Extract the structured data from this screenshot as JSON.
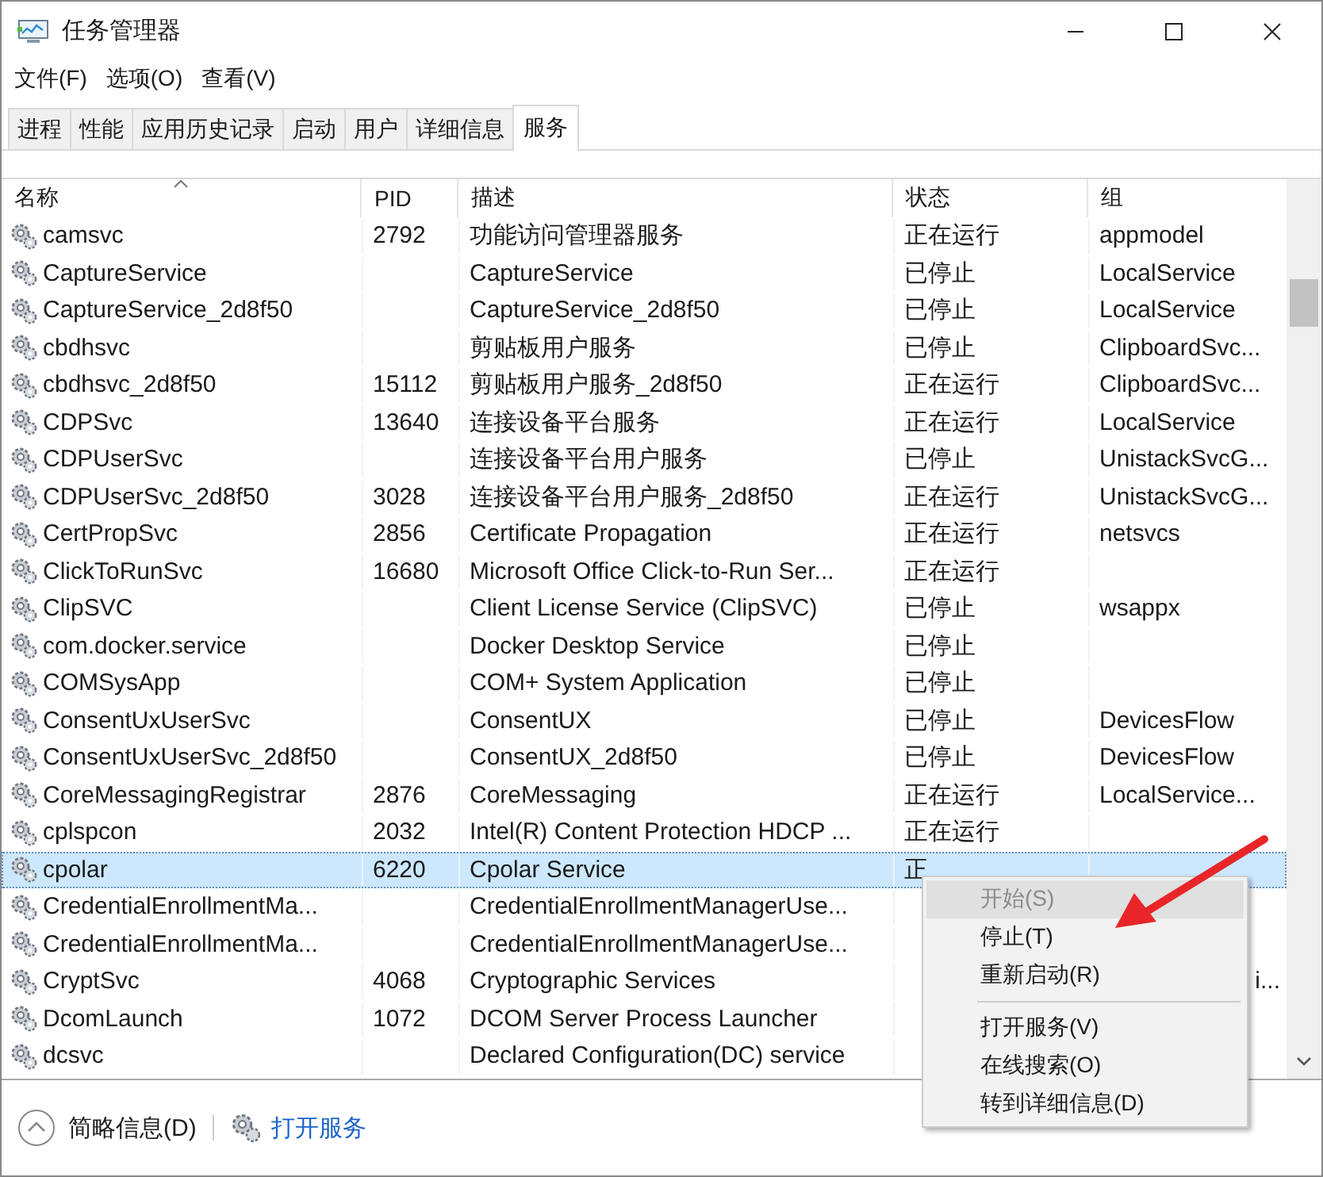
{
  "window": {
    "title": "任务管理器"
  },
  "menu": [
    "文件(F)",
    "选项(O)",
    "查看(V)"
  ],
  "tabs": [
    {
      "label": "进程",
      "selected": false
    },
    {
      "label": "性能",
      "selected": false
    },
    {
      "label": "应用历史记录",
      "selected": false
    },
    {
      "label": "启动",
      "selected": false
    },
    {
      "label": "用户",
      "selected": false
    },
    {
      "label": "详细信息",
      "selected": false
    },
    {
      "label": "服务",
      "selected": true
    }
  ],
  "table": {
    "columns": [
      "名称",
      "PID",
      "描述",
      "状态",
      "组"
    ],
    "rows": [
      {
        "name": "camsvc",
        "pid": "2792",
        "desc": "功能访问管理器服务",
        "status": "正在运行",
        "group": "appmodel",
        "selected": false
      },
      {
        "name": "CaptureService",
        "desc": "CaptureService",
        "status": "已停止",
        "group": "LocalService",
        "selected": false
      },
      {
        "name": "CaptureService_2d8f50",
        "desc": "CaptureService_2d8f50",
        "status": "已停止",
        "group": "LocalService",
        "selected": false
      },
      {
        "name": "cbdhsvc",
        "desc": "剪贴板用户服务",
        "status": "已停止",
        "group": "ClipboardSvc...",
        "selected": false
      },
      {
        "name": "cbdhsvc_2d8f50",
        "pid": "15112",
        "desc": "剪贴板用户服务_2d8f50",
        "status": "正在运行",
        "group": "ClipboardSvc...",
        "selected": false
      },
      {
        "name": "CDPSvc",
        "pid": "13640",
        "desc": "连接设备平台服务",
        "status": "正在运行",
        "group": "LocalService",
        "selected": false
      },
      {
        "name": "CDPUserSvc",
        "desc": "连接设备平台用户服务",
        "status": "已停止",
        "group": "UnistackSvcG...",
        "selected": false
      },
      {
        "name": "CDPUserSvc_2d8f50",
        "pid": "3028",
        "desc": "连接设备平台用户服务_2d8f50",
        "status": "正在运行",
        "group": "UnistackSvcG...",
        "selected": false
      },
      {
        "name": "CertPropSvc",
        "pid": "2856",
        "desc": "Certificate Propagation",
        "status": "正在运行",
        "group": "netsvcs",
        "selected": false
      },
      {
        "name": "ClickToRunSvc",
        "pid": "16680",
        "desc": "Microsoft Office Click-to-Run Ser...",
        "status": "正在运行",
        "selected": false
      },
      {
        "name": "ClipSVC",
        "desc": "Client License Service (ClipSVC)",
        "status": "已停止",
        "group": "wsappx",
        "selected": false
      },
      {
        "name": "com.docker.service",
        "desc": "Docker Desktop Service",
        "status": "已停止",
        "selected": false
      },
      {
        "name": "COMSysApp",
        "desc": "COM+ System Application",
        "status": "已停止",
        "selected": false
      },
      {
        "name": "ConsentUxUserSvc",
        "desc": "ConsentUX",
        "status": "已停止",
        "group": "DevicesFlow",
        "selected": false
      },
      {
        "name": "ConsentUxUserSvc_2d8f50",
        "desc": "ConsentUX_2d8f50",
        "status": "已停止",
        "group": "DevicesFlow",
        "selected": false
      },
      {
        "name": "CoreMessagingRegistrar",
        "pid": "2876",
        "desc": "CoreMessaging",
        "status": "正在运行",
        "group": "LocalService...",
        "selected": false
      },
      {
        "name": "cplspcon",
        "pid": "2032",
        "desc": "Intel(R) Content Protection HDCP ...",
        "status": "正在运行",
        "selected": false
      },
      {
        "name": "cpolar",
        "pid": "6220",
        "desc": "Cpolar Service",
        "status": "正",
        "selected": true
      },
      {
        "name": "CredentialEnrollmentMa...",
        "desc": "CredentialEnrollmentManagerUse...",
        "selected": false
      },
      {
        "name": "CredentialEnrollmentMa...",
        "desc": "CredentialEnrollmentManagerUse...",
        "selected": false
      },
      {
        "name": "CryptSvc",
        "pid": "4068",
        "desc": "Cryptographic Services",
        "group": "i...",
        "group_partial": true,
        "selected": false
      },
      {
        "name": "DcomLaunch",
        "pid": "1072",
        "desc": "DCOM Server Process Launcher",
        "selected": false
      },
      {
        "name": "dcsvc",
        "desc": "Declared Configuration(DC) service",
        "selected": false
      }
    ]
  },
  "context_menu": [
    {
      "kind": "item",
      "label": "开始(S)",
      "disabled": true,
      "selected": true
    },
    {
      "kind": "item",
      "label": "停止(T)",
      "disabled": false,
      "selected": false
    },
    {
      "kind": "item",
      "label": "重新启动(R)",
      "disabled": false,
      "selected": false
    },
    {
      "kind": "separator"
    },
    {
      "kind": "item",
      "label": "打开服务(V)",
      "disabled": false,
      "selected": false
    },
    {
      "kind": "item",
      "label": "在线搜索(O)",
      "disabled": false,
      "selected": false
    },
    {
      "kind": "item",
      "label": "转到详细信息(D)",
      "disabled": false,
      "selected": false
    }
  ],
  "footer": {
    "summary": "简略信息(D)",
    "link": "打开服务"
  }
}
